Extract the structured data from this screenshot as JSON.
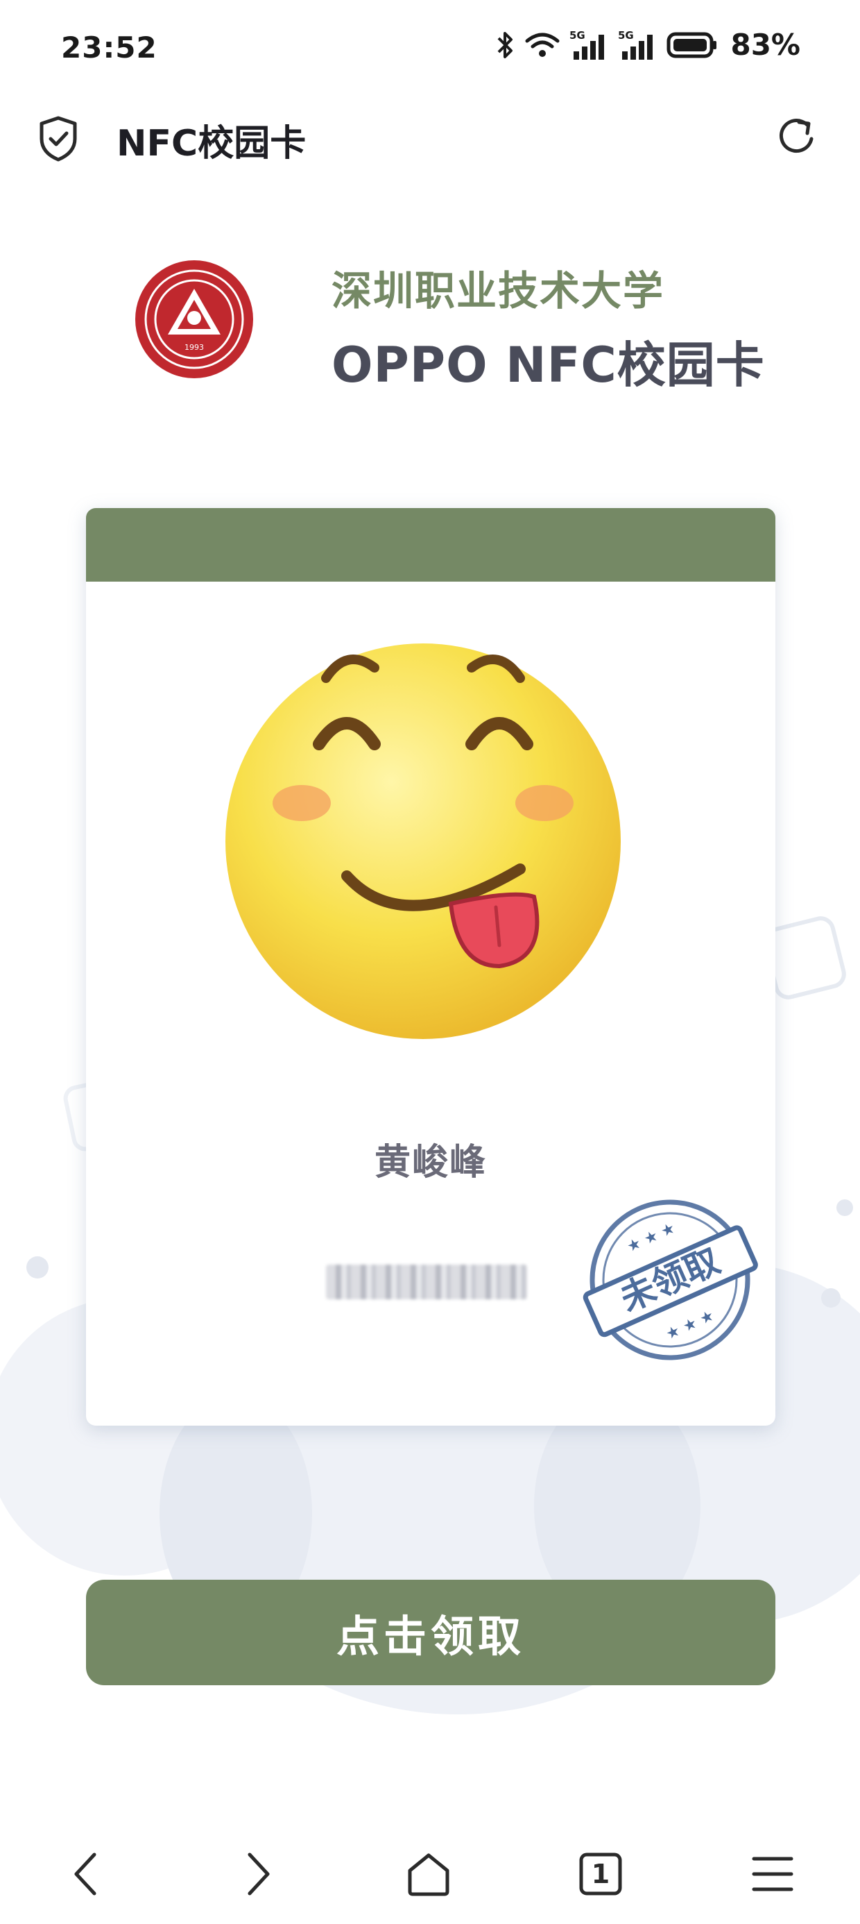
{
  "status_bar": {
    "time": "23:52",
    "battery_percent": "83%",
    "network_1": "5G",
    "network_2": "5G",
    "icons": [
      "bluetooth-icon",
      "wifi-icon",
      "signal-5g-icon",
      "signal-5g-icon",
      "battery-icon"
    ]
  },
  "header": {
    "title": "NFC校园卡",
    "left_icon": "shield-check-icon",
    "right_icon": "refresh-icon"
  },
  "brand": {
    "school_name": "深圳职业技术大学",
    "card_title": "OPPO NFC校园卡",
    "logo_year": "1993"
  },
  "card": {
    "holder_name": "黄峻峰",
    "student_id": "2302306326",
    "student_id_blurred": true,
    "stamp_text": "未领取",
    "avatar_icon": "tongue-out-emoji-icon"
  },
  "actions": {
    "claim_label": "点击领取"
  },
  "bottom_nav": {
    "tab_count": "1",
    "icons": [
      "back-icon",
      "forward-icon",
      "home-icon",
      "tabs-icon",
      "menu-icon"
    ]
  },
  "colors": {
    "accent_green": "#758965",
    "title_gray": "#4a4c5a",
    "stamp_blue": "#4c6c9c",
    "logo_red": "#c0282e"
  }
}
